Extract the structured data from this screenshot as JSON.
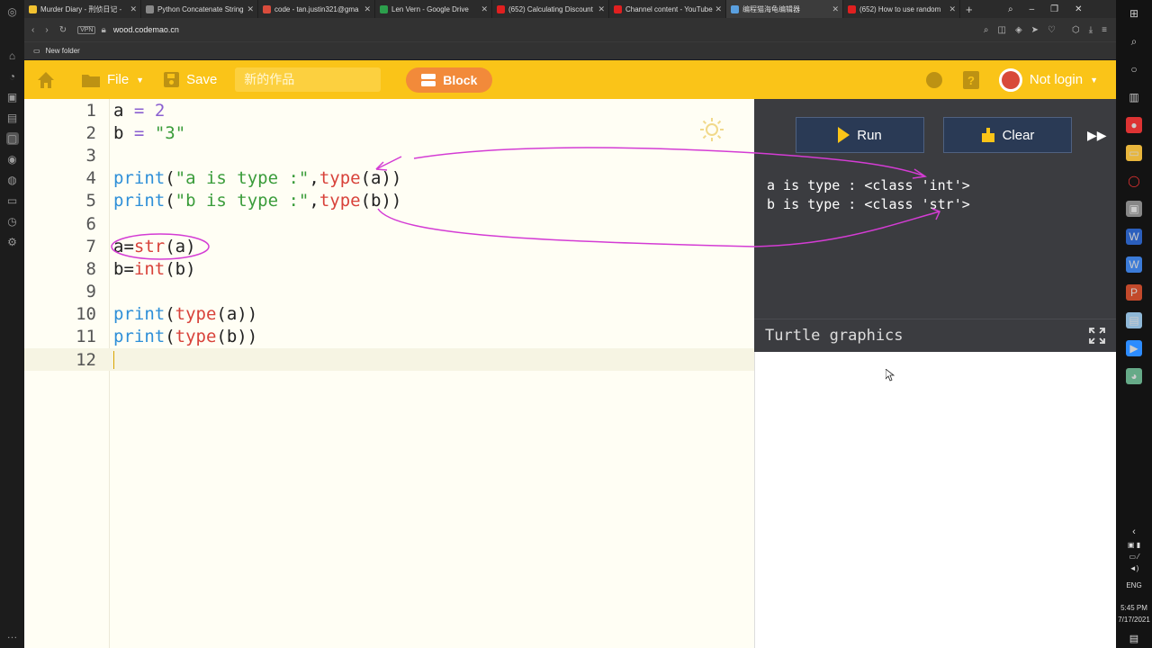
{
  "tabs": [
    {
      "title": "Murder Diary - 刑侦日记 -",
      "color": "#f2c230"
    },
    {
      "title": "Python Concatenate String",
      "color": "#888888"
    },
    {
      "title": "code - tan.justin321@gma",
      "color": "#d94c3c"
    },
    {
      "title": "Len Vern - Google Drive",
      "color": "#2c9f4c"
    },
    {
      "title": "(652) Calculating Discount",
      "color": "#e02020"
    },
    {
      "title": "Channel content - YouTube",
      "color": "#e02020"
    },
    {
      "title": "编程猫海龟编辑器",
      "color": "#5aa0e0",
      "active": true
    },
    {
      "title": "(652) How to use random",
      "color": "#e02020"
    }
  ],
  "address": {
    "vpn": "VPN",
    "url": "wood.codemao.cn"
  },
  "bookmarks": {
    "folder": "New folder"
  },
  "app": {
    "file_label": "File",
    "save_label": "Save",
    "work_placeholder": "新的作品",
    "block_label": "Block",
    "login_label": "Not login"
  },
  "editor": {
    "lines": [
      {
        "num": "1"
      },
      {
        "num": "2"
      },
      {
        "num": "3"
      },
      {
        "num": "4"
      },
      {
        "num": "5"
      },
      {
        "num": "6"
      },
      {
        "num": "7"
      },
      {
        "num": "8"
      },
      {
        "num": "9"
      },
      {
        "num": "10"
      },
      {
        "num": "11"
      },
      {
        "num": "12"
      }
    ],
    "code": {
      "l1a": "a",
      "l1op": "=",
      "l1v": "2",
      "l2a": "b",
      "l2op": "=",
      "l2v": "\"3\"",
      "l4p": "print",
      "l4s": "\"a is type :\"",
      "l4t": "type",
      "l4arg": "(a)",
      "l5p": "print",
      "l5s": "\"b is type :\"",
      "l5t": "type",
      "l5arg": "(b)",
      "l7a": "a=",
      "l7f": "str",
      "l7arg": "(a)",
      "l8a": "b=",
      "l8f": "int",
      "l8arg": "(b)",
      "l10p": "print",
      "l10t": "type",
      "l10arg": "(a))",
      "l11p": "print",
      "l11t": "type",
      "l11arg": "(b))"
    }
  },
  "console": {
    "run_label": "Run",
    "clear_label": "Clear",
    "output": [
      "a is type : <class 'int'>",
      "b is type : <class 'str'>"
    ]
  },
  "turtle": {
    "title": "Turtle graphics"
  },
  "taskbar": {
    "lang": "ENG",
    "time": "5:45 PM",
    "date": "7/17/2021"
  }
}
